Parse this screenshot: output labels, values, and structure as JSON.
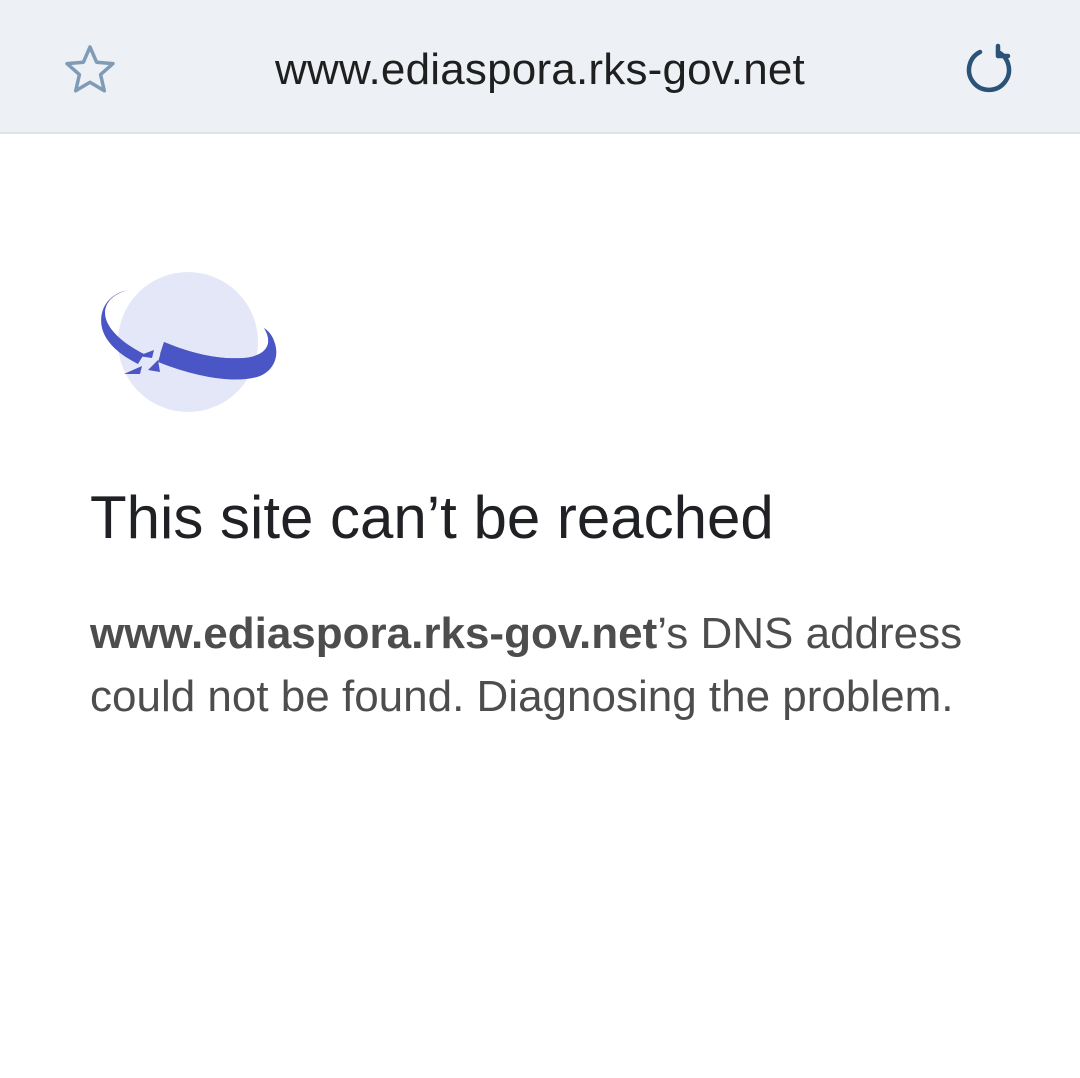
{
  "toolbar": {
    "url": "www.ediaspora.rks-gov.net",
    "bookmark_icon": "star-outline-icon",
    "reload_icon": "reload-icon"
  },
  "error_page": {
    "graphic_icon": "dino-planet-offline-icon",
    "title": "This site can’t be reached",
    "host": "www.ediaspora.rks-gov.net",
    "message_suffix": "’s DNS address could not be found. Diagnosing the problem."
  },
  "colors": {
    "toolbar_bg": "#edf0f4",
    "star_icon": "#7f9bb8",
    "reload_icon": "#2b5277",
    "planet_light": "#e3e7f8",
    "planet_ring": "#4a56c6",
    "title_text": "#202124",
    "body_text": "#4d4d4d"
  }
}
